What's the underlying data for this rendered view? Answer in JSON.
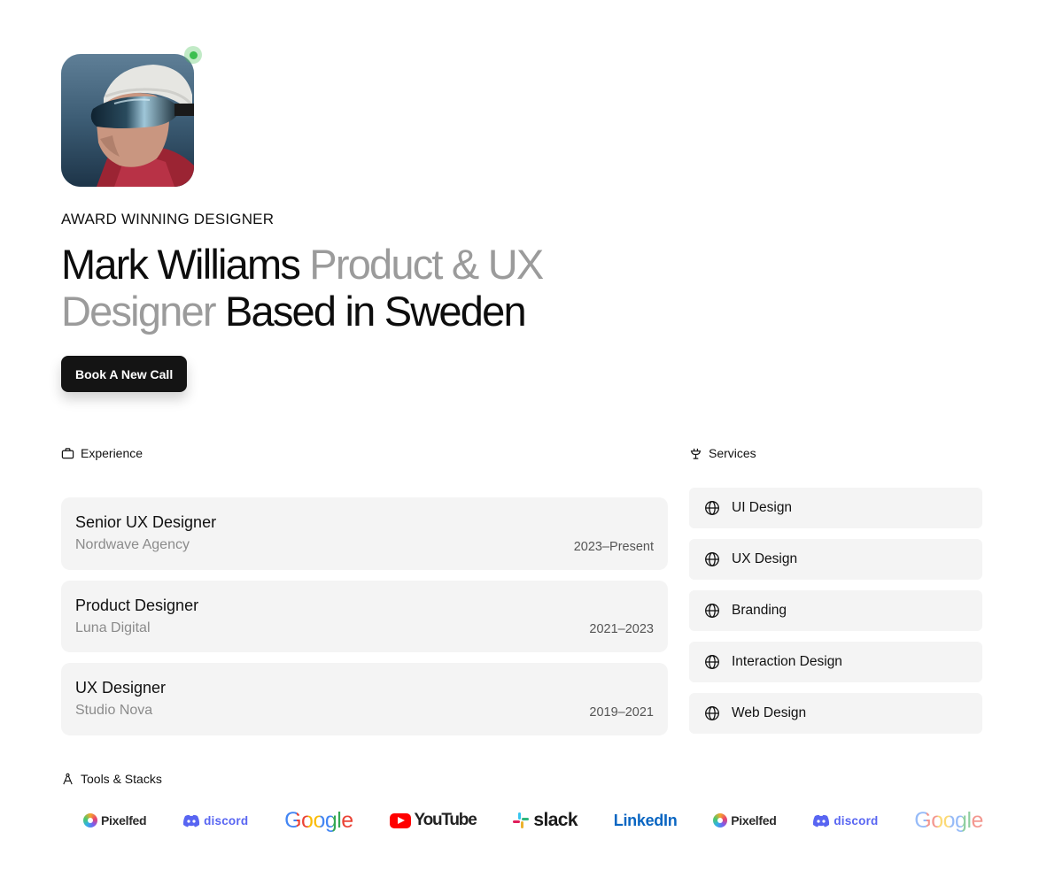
{
  "hero": {
    "eyebrow": "AWARD WINNING DESIGNER",
    "headline": {
      "part1": "Mark Williams",
      "part2": "Product & UX Designer",
      "part3": "Based in Sweden"
    },
    "cta_label": "Book A New Call",
    "avatar_icon": "avatar-photo",
    "status_color": "#3cbf4f"
  },
  "experience": {
    "label": "Experience",
    "icon": "briefcase-icon",
    "items": [
      {
        "title": "Senior UX Designer",
        "company": "Nordwave Agency",
        "years": "2023–Present"
      },
      {
        "title": "Product Designer",
        "company": "Luna Digital",
        "years": "2021–2023"
      },
      {
        "title": "UX Designer",
        "company": "Studio Nova",
        "years": "2019–2021"
      }
    ]
  },
  "services": {
    "label": "Services",
    "icon": "dining-icon",
    "item_icon": "globe-icon",
    "items": [
      {
        "label": "UI Design"
      },
      {
        "label": "UX Design"
      },
      {
        "label": "Branding"
      },
      {
        "label": "Interaction Design"
      },
      {
        "label": "Web Design"
      }
    ]
  },
  "tools": {
    "label": "Tools & Stacks",
    "icon": "compass-icon",
    "logos": [
      {
        "name": "Pixelfed"
      },
      {
        "name": "Discord"
      },
      {
        "name": "Google"
      },
      {
        "name": "YouTube"
      },
      {
        "name": "slack"
      },
      {
        "name": "LinkedIn"
      },
      {
        "name": "Pixelfed"
      },
      {
        "name": "Discord"
      },
      {
        "name": "Google"
      }
    ]
  },
  "colors": {
    "accent_dark": "#141414",
    "muted_text": "#9b9b9b",
    "card_bg": "#f4f4f4"
  }
}
